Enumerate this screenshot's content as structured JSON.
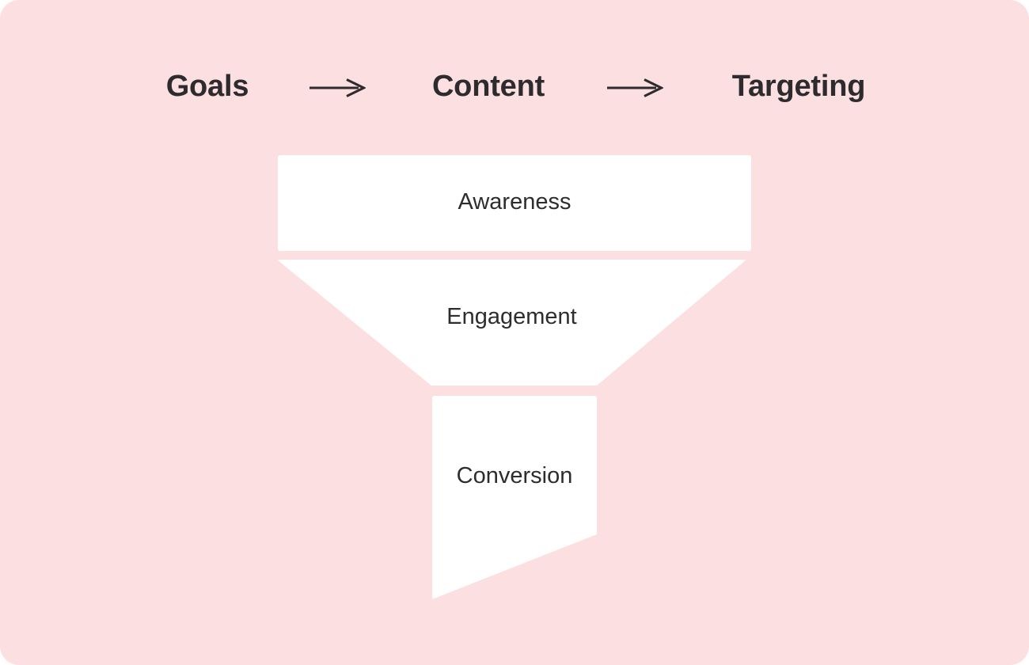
{
  "theme": {
    "background_color": "#FCDFE0",
    "stage_fill_color": "#FFFFFF",
    "text_color": "#2D2B2E",
    "stage_label_color": "#2D2D2F"
  },
  "steps": {
    "items": [
      {
        "label": "Goals"
      },
      {
        "label": "Content"
      },
      {
        "label": "Targeting"
      }
    ],
    "separators": [
      {
        "icon": "long-right-arrow-icon"
      },
      {
        "icon": "long-right-arrow-icon"
      }
    ]
  },
  "funnel": {
    "stages": [
      {
        "label": "Awareness",
        "shape": "rectangle"
      },
      {
        "label": "Engagement",
        "shape": "trapezoid"
      },
      {
        "label": "Conversion",
        "shape": "quadrilateral"
      }
    ]
  }
}
